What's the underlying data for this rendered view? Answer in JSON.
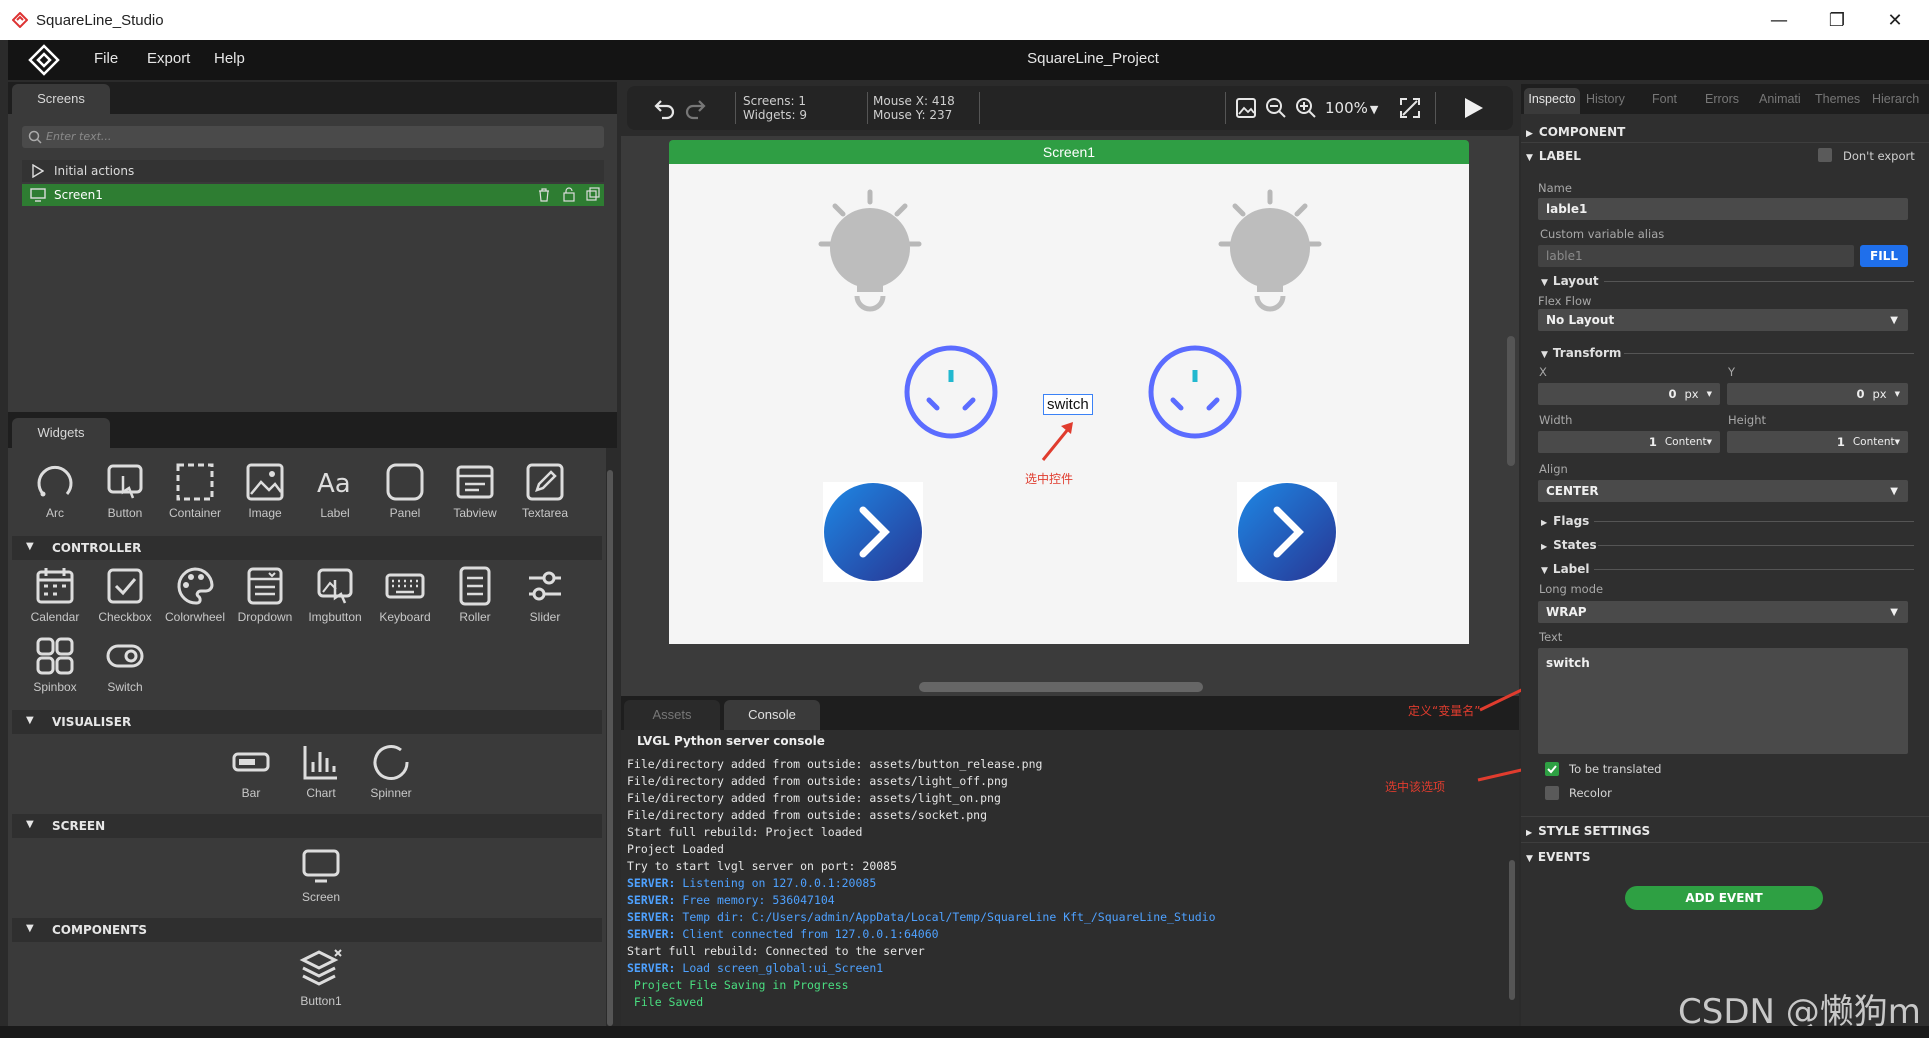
{
  "window": {
    "title": "SquareLine_Studio",
    "min": "—",
    "max": "❐",
    "close": "✕"
  },
  "menu": {
    "file": "File",
    "export": "Export",
    "help": "Help",
    "project_title": "SquareLine_Project"
  },
  "screens_panel": {
    "tab": "Screens",
    "search_placeholder": "Enter text...",
    "items": [
      {
        "label": "Initial actions"
      },
      {
        "label": "Screen1"
      }
    ]
  },
  "widgets_panel": {
    "tab": "Widgets",
    "basic": [
      "Arc",
      "Button",
      "Container",
      "Image",
      "Label",
      "Panel",
      "Tabview",
      "Textarea"
    ],
    "controller_header": "CONTROLLER",
    "controller": [
      "Calendar",
      "Checkbox",
      "Colorwheel",
      "Dropdown",
      "Imgbutton",
      "Keyboard",
      "Roller",
      "Slider",
      "Spinbox",
      "Switch"
    ],
    "visualiser_header": "VISUALISER",
    "visualiser": [
      "Bar",
      "Chart",
      "Spinner"
    ],
    "screen_header": "SCREEN",
    "screen": [
      "Screen"
    ],
    "components_header": "COMPONENTS",
    "components": [
      "Button1"
    ]
  },
  "toolbar": {
    "screens": "Screens: 1",
    "widgets": "Widgets: 9",
    "mouse_x": "Mouse X: 418",
    "mouse_y": "Mouse Y: 237",
    "zoom": "100%"
  },
  "canvas": {
    "screen_name": "Screen1",
    "selected_label": "switch",
    "annotation_select": "选中控件"
  },
  "console": {
    "tab_assets": "Assets",
    "tab_console": "Console",
    "title": "LVGL Python server console",
    "lines": [
      {
        "tag": "",
        "text": "File/directory added from outside: assets/button_release.png",
        "kind": "normal"
      },
      {
        "tag": "",
        "text": "File/directory added from outside: assets/light_off.png",
        "kind": "normal"
      },
      {
        "tag": "",
        "text": "File/directory added from outside: assets/light_on.png",
        "kind": "normal"
      },
      {
        "tag": "",
        "text": "File/directory added from outside: assets/socket.png",
        "kind": "normal"
      },
      {
        "tag": "",
        "text": "Start full rebuild: Project loaded",
        "kind": "normal"
      },
      {
        "tag": "",
        "text": "Project Loaded",
        "kind": "normal"
      },
      {
        "tag": "",
        "text": "Try to start lvgl server on port: 20085",
        "kind": "normal"
      },
      {
        "tag": "SERVER:",
        "text": " Listening on 127.0.0.1:20085",
        "kind": "server"
      },
      {
        "tag": "SERVER:",
        "text": " Free memory: 536047104",
        "kind": "server"
      },
      {
        "tag": "SERVER:",
        "text": " Temp dir: C:/Users/admin/AppData/Local/Temp/SquareLine Kft_/SquareLine_Studio",
        "kind": "server"
      },
      {
        "tag": "SERVER:",
        "text": " Client connected from 127.0.0.1:64060",
        "kind": "server"
      },
      {
        "tag": "",
        "text": "Start full rebuild: Connected to the server",
        "kind": "normal"
      },
      {
        "tag": "SERVER:",
        "text": " Load screen_global:ui_Screen1",
        "kind": "server"
      },
      {
        "tag": "",
        "text": " Project File Saving in Progress",
        "kind": "green"
      },
      {
        "tag": "",
        "text": " File Saved",
        "kind": "green"
      }
    ],
    "annotation_varname": "定义“变量名”",
    "annotation_option": "选中该选项"
  },
  "inspector": {
    "tabs": [
      "Inspecto",
      "History",
      "Font",
      "Errors",
      "Animati",
      "Themes",
      "Hierarch"
    ],
    "component": "COMPONENT",
    "label": "LABEL",
    "dont_export": "Don't export",
    "name_label": "Name",
    "name_value": "lable1",
    "alias_label": "Custom variable alias",
    "alias_value": "lable1",
    "fill": "FILL",
    "layout": "Layout",
    "flex_flow": "Flex Flow",
    "flex_value": "No Layout",
    "transform": "Transform",
    "x_label": "X",
    "y_label": "Y",
    "x_value": "0",
    "y_value": "0",
    "px": "px",
    "width_label": "Width",
    "height_label": "Height",
    "width_value": "1",
    "height_value": "1",
    "content": "Content",
    "align_label": "Align",
    "align_value": "CENTER",
    "flags": "Flags",
    "states": "States",
    "label_sub": "Label",
    "long_mode": "Long mode",
    "long_mode_value": "WRAP",
    "text_label": "Text",
    "text_value": "switch",
    "translate": "To be translated",
    "recolor": "Recolor",
    "style_settings": "STYLE SETTINGS",
    "events": "EVENTS",
    "add_event": "ADD EVENT"
  },
  "watermark": "CSDN @懒狗m"
}
